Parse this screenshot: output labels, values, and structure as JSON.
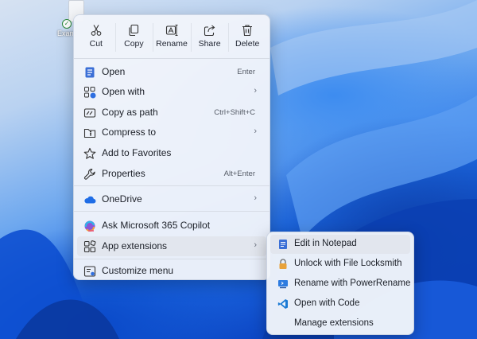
{
  "desktop": {
    "file_label": "Exam"
  },
  "toolbar": [
    {
      "label": "Cut",
      "icon": "scissors-icon"
    },
    {
      "label": "Copy",
      "icon": "copy-icon"
    },
    {
      "label": "Rename",
      "icon": "rename-icon"
    },
    {
      "label": "Share",
      "icon": "share-icon"
    },
    {
      "label": "Delete",
      "icon": "trash-icon"
    }
  ],
  "menu": {
    "open": {
      "label": "Open",
      "shortcut": "Enter"
    },
    "open_with": {
      "label": "Open with"
    },
    "copy_as_path": {
      "label": "Copy as path",
      "shortcut": "Ctrl+Shift+C"
    },
    "compress_to": {
      "label": "Compress to"
    },
    "add_to_favorites": {
      "label": "Add to Favorites"
    },
    "properties": {
      "label": "Properties",
      "shortcut": "Alt+Enter"
    },
    "onedrive": {
      "label": "OneDrive"
    },
    "ask_copilot": {
      "label": "Ask Microsoft 365 Copilot"
    },
    "app_extensions": {
      "label": "App extensions"
    },
    "customize_menu": {
      "label": "Customize menu"
    }
  },
  "submenu": [
    {
      "label": "Edit in Notepad",
      "icon": "notepad-icon"
    },
    {
      "label": "Unlock with File Locksmith",
      "icon": "lock-icon"
    },
    {
      "label": "Rename with PowerRename",
      "icon": "powerrename-icon"
    },
    {
      "label": "Open with Code",
      "icon": "vscode-icon"
    },
    {
      "label": "Manage extensions",
      "icon": ""
    }
  ],
  "colors": {
    "accent": "#1f6de6",
    "menu_bg": "#f0f4fa"
  }
}
